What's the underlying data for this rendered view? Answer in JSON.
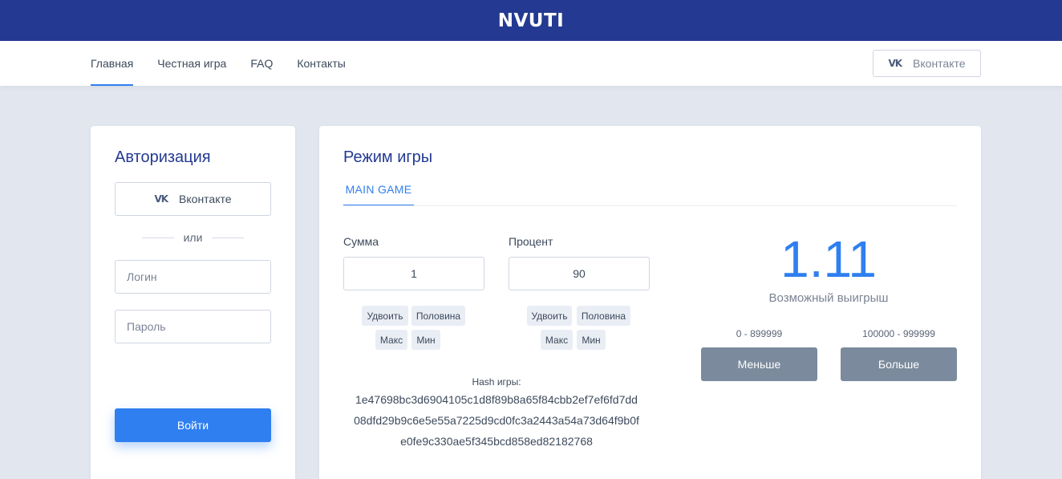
{
  "header": {
    "brand": "NVUTI"
  },
  "nav": {
    "links": [
      "Главная",
      "Честная игра",
      "FAQ",
      "Контакты"
    ],
    "vk_label": "Вконтакте"
  },
  "auth": {
    "title": "Авторизация",
    "vk_label": "Вконтакте",
    "or_label": "или",
    "login_placeholder": "Логин",
    "password_placeholder": "Пароль",
    "submit_label": "Войти"
  },
  "game": {
    "title": "Режим игры",
    "tab_label": "MAIN GAME",
    "sum": {
      "label": "Сумма",
      "value": "1",
      "buttons": {
        "double": "Удвоить",
        "half": "Половина",
        "max": "Макс",
        "min": "Мин"
      }
    },
    "percent": {
      "label": "Процент",
      "value": "90",
      "buttons": {
        "double": "Удвоить",
        "half": "Половина",
        "max": "Макс",
        "min": "Мин"
      }
    },
    "hash": {
      "title": "Hash игры:",
      "lines": [
        "1e47698bc3d6904105c1d8f89b8a65f84cbb2ef7ef6fd7dd",
        "08dfd29b9c6e5e55a7225d9cd0fc3a2443a54a73d64f9b0f",
        "e0fe9c330ae5f345bcd858ed82182768"
      ]
    },
    "possible_win": {
      "value": "1.11",
      "label": "Возможный выигрыш"
    },
    "less": {
      "range": "0 - 899999",
      "label": "Меньше"
    },
    "more": {
      "range": "100000 - 999999",
      "label": "Больше"
    }
  },
  "colors": {
    "header_bg": "#243a92",
    "accent": "#2f7ff0",
    "page_bg": "#e1e6ef",
    "bet_button": "#7b8a9c"
  },
  "icons": {
    "vk": "vk-icon"
  }
}
